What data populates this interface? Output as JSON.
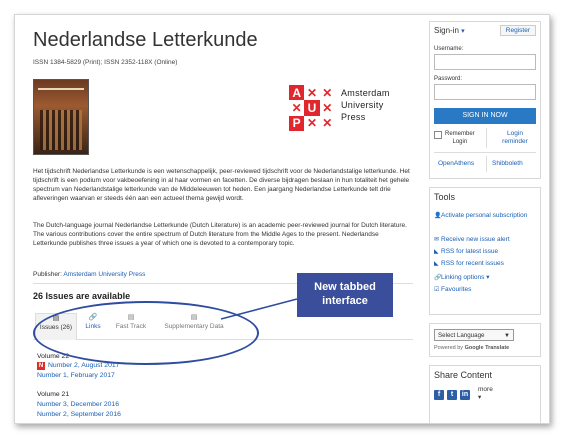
{
  "journal": {
    "title": "Nederlandse Letterkunde",
    "issn": "ISSN 1384-5829 (Print); ISSN 2352-118X (Online)"
  },
  "publisher_logo": {
    "letters": [
      "A",
      "U",
      "P"
    ],
    "name_lines": [
      "Amsterdam",
      "University",
      "Press"
    ]
  },
  "description": {
    "dutch": "Het tijdschrift Nederlandse Letterkunde is een wetenschappelijk, peer-reviewed tijdschrift voor de Nederlandstalige letterkunde. Het tijdschrift is een podium voor vakbeoefening in al haar vormen en facetten. De diverse bijdragen beslaan in hun totaliteit het gehele spectrum van Nederlandstalige letterkunde van de Middeleeuwen tot heden. Een jaargang Nederlandse Letterkunde telt drie afleveringen waarvan er steeds één aan een actueel thema gewijd wordt.",
    "english": "The Dutch-language journal Nederlandse Letterkunde (Dutch Literature) is an academic peer-reviewed journal for Dutch literature. The various contributions cover the entire spectrum of Dutch literature from the Middle Ages to the present. Nederlandse Letterkunde publishes three issues a year of which one is devoted to a contemporary topic."
  },
  "publisher": {
    "label": "Publisher:",
    "name": "Amsterdam University Press"
  },
  "issues_count": "26 Issues are available",
  "tabs": [
    {
      "label": "Issues (26)",
      "icon": "list-icon"
    },
    {
      "label": "Links",
      "icon": "link-icon"
    },
    {
      "label": "Fast Track",
      "icon": "list-icon"
    },
    {
      "label": "Supplementary Data",
      "icon": "list-icon"
    }
  ],
  "volumes": [
    {
      "label": "Volume 22",
      "issues": [
        {
          "label": "Number 2, August 2017",
          "badge": "N"
        },
        {
          "label": "Number 1, February 2017"
        }
      ]
    },
    {
      "label": "Volume 21",
      "issues": [
        {
          "label": "Number 3, December 2016"
        },
        {
          "label": "Number 2, September 2016"
        }
      ]
    }
  ],
  "callout": {
    "line1": "New tabbed",
    "line2": "interface"
  },
  "signin": {
    "heading": "Sign-in",
    "register": "Register",
    "username_label": "Username:",
    "password_label": "Password:",
    "button": "SIGN IN NOW",
    "remember": "Remember Login",
    "remember_line1": "Remember",
    "remember_line2": "Login",
    "reminder_line1": "Login",
    "reminder_line2": "reminder",
    "openathens": "OpenAthens",
    "shibboleth": "Shibboleth"
  },
  "tools": {
    "heading": "Tools",
    "items": [
      {
        "label": "Activate personal subscription",
        "icon": "user-icon"
      },
      {
        "label": "Receive new issue alert",
        "icon": "envelope-icon"
      },
      {
        "label": "RSS for latest issue",
        "icon": "rss-icon"
      },
      {
        "label": "RSS for recent issues",
        "icon": "rss-icon"
      },
      {
        "label": "Linking options",
        "icon": "link-icon"
      },
      {
        "label": "Favourites",
        "icon": "checkbox-icon"
      }
    ]
  },
  "language": {
    "select": "Select Language",
    "powered_prefix": "Powered by",
    "powered_brand": "Google",
    "powered_suffix": "Translate"
  },
  "share": {
    "heading": "Share Content",
    "more": "more",
    "icons": [
      "facebook-icon",
      "twitter-icon",
      "linkedin-icon"
    ]
  },
  "colors": {
    "link": "#1a5fb4",
    "signin_button": "#2a79c4",
    "callout": "#3a4e9c",
    "aup_red": "#e1262d"
  }
}
